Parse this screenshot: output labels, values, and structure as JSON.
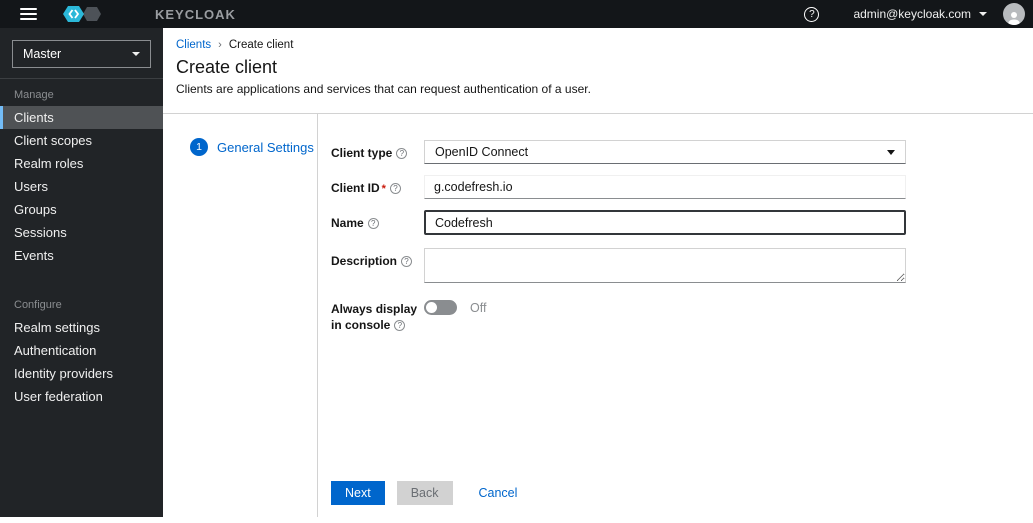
{
  "colors": {
    "primary_blue": "#0066cc",
    "brand_cyan": "#2bb8d9",
    "masthead_bg": "#131619",
    "sidebar_bg": "#212427",
    "active_indicator": "#73bcf7",
    "required_red": "#c9190b"
  },
  "masthead": {
    "brand_text": "KEYCLOAK",
    "username": "admin@keycloak.com"
  },
  "sidebar": {
    "realm": "Master",
    "sections": [
      {
        "label": "Manage",
        "items": [
          {
            "label": "Clients"
          },
          {
            "label": "Client scopes"
          },
          {
            "label": "Realm roles"
          },
          {
            "label": "Users"
          },
          {
            "label": "Groups"
          },
          {
            "label": "Sessions"
          },
          {
            "label": "Events"
          }
        ]
      },
      {
        "label": "Configure",
        "items": [
          {
            "label": "Realm settings"
          },
          {
            "label": "Authentication"
          },
          {
            "label": "Identity providers"
          },
          {
            "label": "User federation"
          }
        ]
      }
    ]
  },
  "breadcrumb": {
    "parent": "Clients",
    "separator": "›",
    "current": "Create client"
  },
  "page": {
    "title": "Create client",
    "subtitle": "Clients are applications and services that can request authentication of a user."
  },
  "wizard": {
    "step_number": "1",
    "step_label": "General Settings"
  },
  "form": {
    "client_type": {
      "label": "Client type",
      "help": "?",
      "value": "OpenID Connect"
    },
    "client_id": {
      "label": "Client ID",
      "required_marker": "*",
      "help": "?",
      "value": "g.codefresh.io"
    },
    "name": {
      "label": "Name",
      "help": "?",
      "value": "Codefresh"
    },
    "description": {
      "label": "Description",
      "help": "?",
      "value": ""
    },
    "always_display": {
      "label": "Always display in console",
      "help": "?",
      "state": "Off"
    },
    "actions": {
      "next": "Next",
      "back": "Back",
      "cancel": "Cancel"
    }
  }
}
